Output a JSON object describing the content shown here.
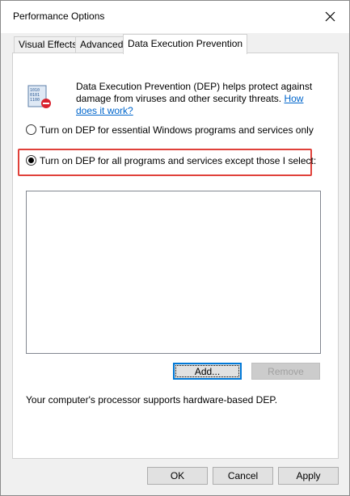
{
  "window": {
    "title": "Performance Options"
  },
  "tabs": [
    {
      "label": "Visual Effects"
    },
    {
      "label": "Advanced"
    },
    {
      "label": "Data Execution Prevention"
    }
  ],
  "dep": {
    "description": "Data Execution Prevention (DEP) helps protect against damage from viruses and other security threats.",
    "link_text": "How does it work?",
    "option_essential": "Turn on DEP for essential Windows programs and services only",
    "option_all": "Turn on DEP for all programs and services except those I select:",
    "selected_option": "all",
    "exceptions": [],
    "add_label": "Add...",
    "remove_label": "Remove",
    "support_text": "Your computer's processor supports hardware-based DEP."
  },
  "footer": {
    "ok_label": "OK",
    "cancel_label": "Cancel",
    "apply_label": "Apply"
  },
  "colors": {
    "highlight": "#e0413a",
    "link": "#0066cc",
    "focus": "#0078d7"
  },
  "icons": {
    "close": "close-icon",
    "dep": "dep-shield-icon"
  }
}
